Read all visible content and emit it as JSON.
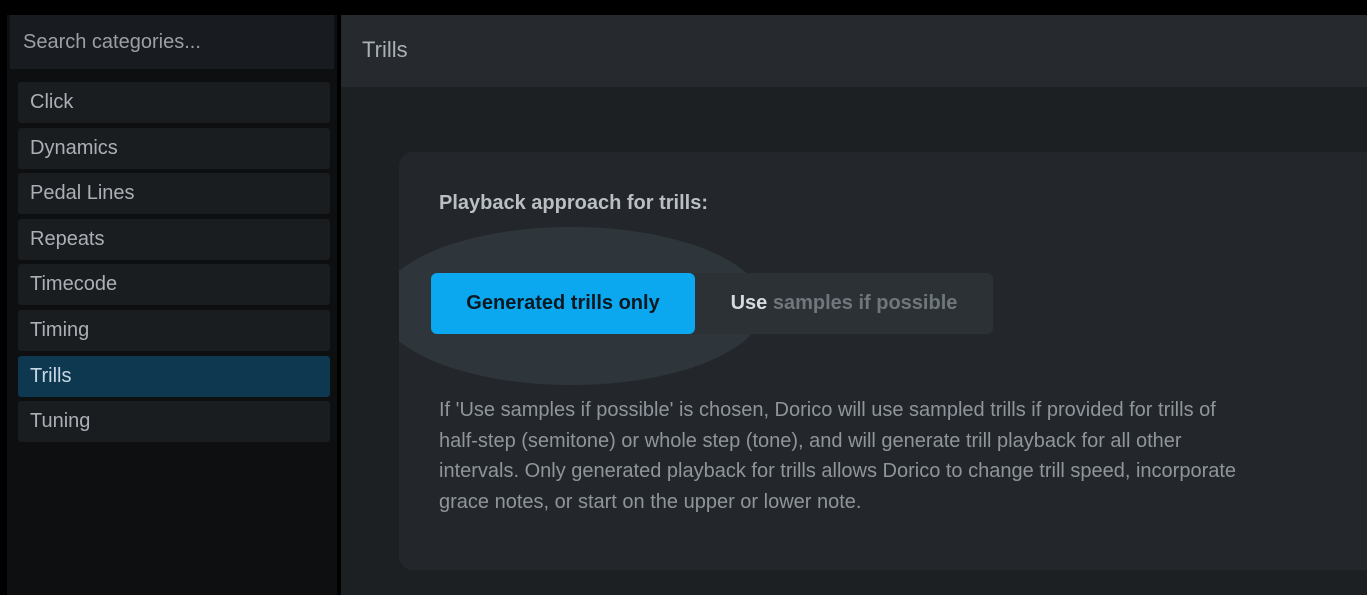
{
  "search": {
    "placeholder": "Search categories..."
  },
  "sidebar": {
    "items": [
      {
        "label": "Click"
      },
      {
        "label": "Dynamics"
      },
      {
        "label": "Pedal Lines"
      },
      {
        "label": "Repeats"
      },
      {
        "label": "Timecode"
      },
      {
        "label": "Timing"
      },
      {
        "label": "Trills",
        "selected": true
      },
      {
        "label": "Tuning"
      }
    ]
  },
  "main": {
    "title": "Trills",
    "option": {
      "label": "Playback approach for trills:",
      "choices": {
        "generated": "Generated trills only",
        "samples_highlight": "Use",
        "samples_rest": " samples if possible"
      },
      "description": {
        "line1": "If 'Use samples if possible' is chosen, Dorico will use sampled trills if provided for trills of",
        "line2": "half-step (semitone) or whole step (tone), and will generate trill playback for all other",
        "line3": "intervals. Only generated playback for trills allows Dorico to change trill speed, incorporate",
        "line4": "grace notes, or start on the upper or lower note."
      }
    }
  },
  "colors": {
    "accent": "#0ba8ef",
    "selected_item": "#0e3850"
  }
}
